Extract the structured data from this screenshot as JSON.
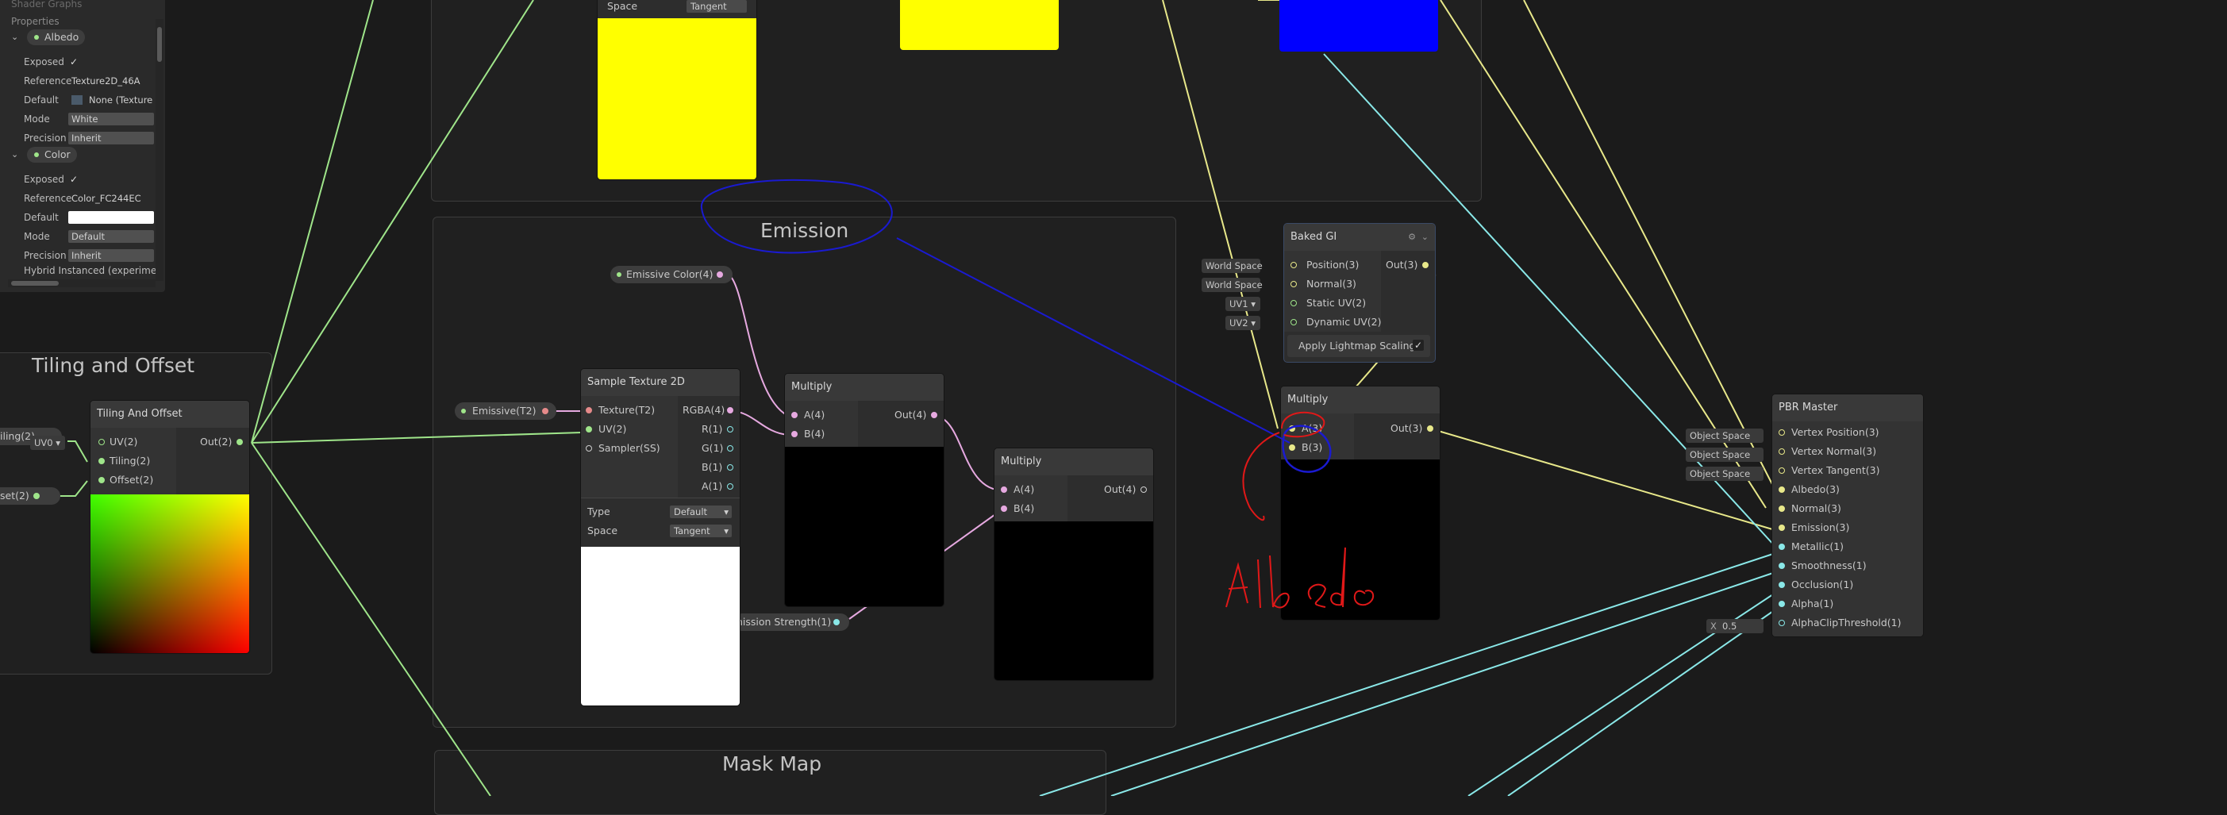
{
  "blackboard": {
    "title": "Shader Graphs",
    "section": "Properties",
    "props": [
      {
        "name": "Albedo",
        "rows": [
          {
            "label": "Exposed",
            "value": "✓"
          },
          {
            "label": "Reference",
            "value": "Texture2D_46A"
          },
          {
            "label": "Default",
            "value": "None (Texture"
          },
          {
            "label": "Mode",
            "value": "White"
          },
          {
            "label": "Precision",
            "value": "Inherit"
          }
        ]
      },
      {
        "name": "Color",
        "rows": [
          {
            "label": "Exposed",
            "value": "✓"
          },
          {
            "label": "Reference",
            "value": "Color_FC244EC"
          },
          {
            "label": "Default",
            "value": ""
          },
          {
            "label": "Mode",
            "value": "Default"
          },
          {
            "label": "Precision",
            "value": "Inherit"
          }
        ]
      }
    ],
    "footer_item": "Hybrid Instanced (experimen"
  },
  "groups": {
    "emission": "Emission",
    "tiling": "Tiling and Offset",
    "mask_map": "Mask Map"
  },
  "top_node": {
    "label": "Space",
    "value": "Tangent"
  },
  "tiling_node": {
    "title": "Tiling And Offset",
    "inputs": [
      "UV(2)",
      "Tiling(2)",
      "Offset(2)"
    ],
    "output": "Out(2)",
    "uv_slot": "UV0",
    "left_pill_1": "iling(2)",
    "left_pill_2": "set(2)"
  },
  "emissive_color": "Emissive Color(4)",
  "emissive_tex": "Emissive(T2)",
  "emission_strength": "nission Strength(1)",
  "sample_tex": {
    "title": "Sample Texture 2D",
    "inputs": [
      "Texture(T2)",
      "UV(2)",
      "Sampler(SS)"
    ],
    "outputs": [
      "RGBA(4)",
      "R(1)",
      "G(1)",
      "B(1)",
      "A(1)"
    ],
    "type_label": "Type",
    "type_value": "Default",
    "space_label": "Space",
    "space_value": "Tangent"
  },
  "multiply1": {
    "title": "Multiply",
    "inputs": [
      "A(4)",
      "B(4)"
    ],
    "output": "Out(4)"
  },
  "multiply2": {
    "title": "Multiply",
    "inputs": [
      "A(4)",
      "B(4)"
    ],
    "output": "Out(4)"
  },
  "multiply3": {
    "title": "Multiply",
    "inputs": [
      "A(3)",
      "B(3)"
    ],
    "output": "Out(3)"
  },
  "baked_gi": {
    "title": "Baked GI",
    "inputs": [
      "Position(3)",
      "Normal(3)",
      "Static UV(2)",
      "Dynamic UV(2)"
    ],
    "output": "Out(3)",
    "slots": [
      "World Space",
      "World Space",
      "UV1",
      "UV2"
    ],
    "toggle": "Apply Lightmap Scaling"
  },
  "pbr": {
    "title": "PBR Master",
    "inputs": [
      "Vertex Position(3)",
      "Vertex Normal(3)",
      "Vertex Tangent(3)",
      "Albedo(3)",
      "Normal(3)",
      "Emission(3)",
      "Metallic(1)",
      "Smoothness(1)",
      "Occlusion(1)",
      "Alpha(1)",
      "AlphaClipThreshold(1)"
    ],
    "slots": [
      "Object Space",
      "Object Space",
      "Object Space"
    ],
    "clip_x": "X",
    "clip_value": "0.5"
  },
  "colors": {
    "canvas": "#1b1b1b",
    "green_wire": "#9fe58a",
    "yellow_wire": "#e8e88a",
    "cyan_wire": "#8ae8e8",
    "pink_wire": "#e6a9e0",
    "annotation_blue": "#1a1ad0",
    "annotation_red": "#e01818"
  }
}
